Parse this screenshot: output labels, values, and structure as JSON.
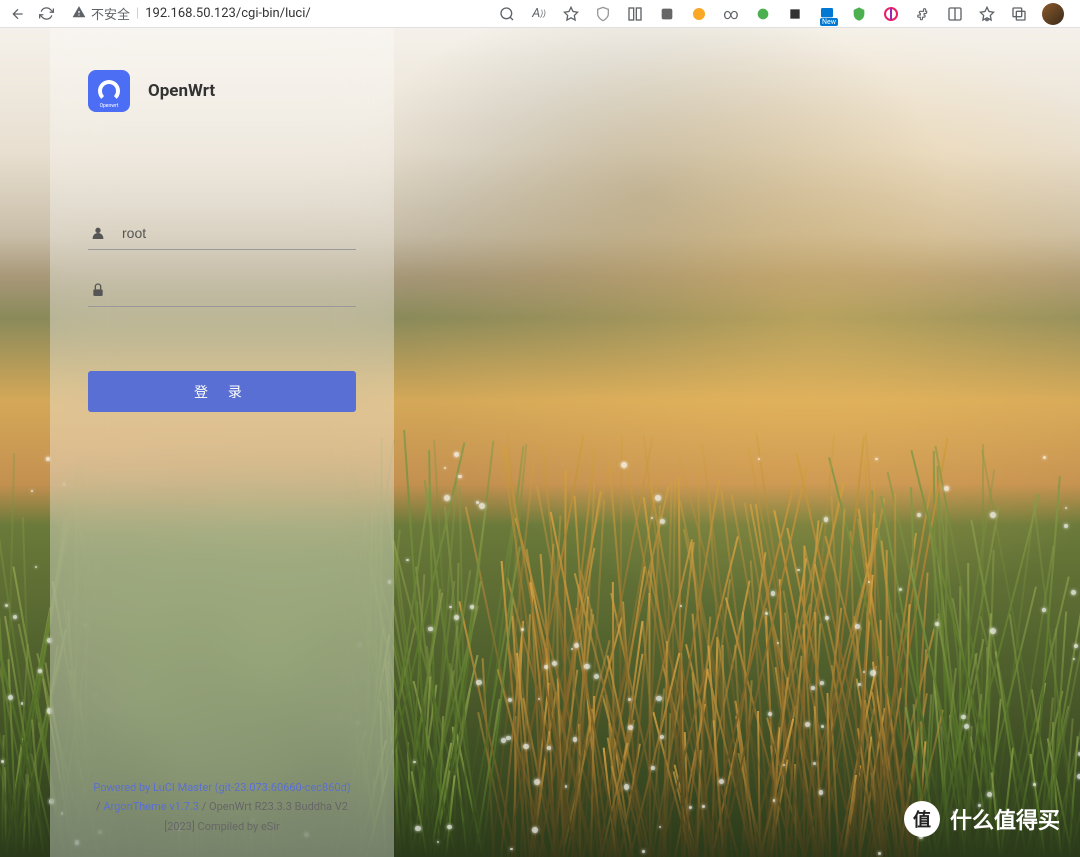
{
  "browser": {
    "security_text": "不安全",
    "url": "192.168.50.123/cgi-bin/luci/",
    "new_badge": "New"
  },
  "login": {
    "brand": "OpenWrt",
    "logo_label": "Openwrt",
    "username_value": "root",
    "password_value": "",
    "button_label": "登 录"
  },
  "footer": {
    "luci_link": "Powered by LuCI Master (git-23.073.60660-cec860d)",
    "separator1": " / ",
    "theme_link": "ArgonTheme v1.7.3",
    "version_text": " / OpenWrt R23.3.3 Buddha V2 [2023] Compiled by eSir"
  },
  "watermark": {
    "icon_text": "值",
    "text": "什么值得买"
  }
}
